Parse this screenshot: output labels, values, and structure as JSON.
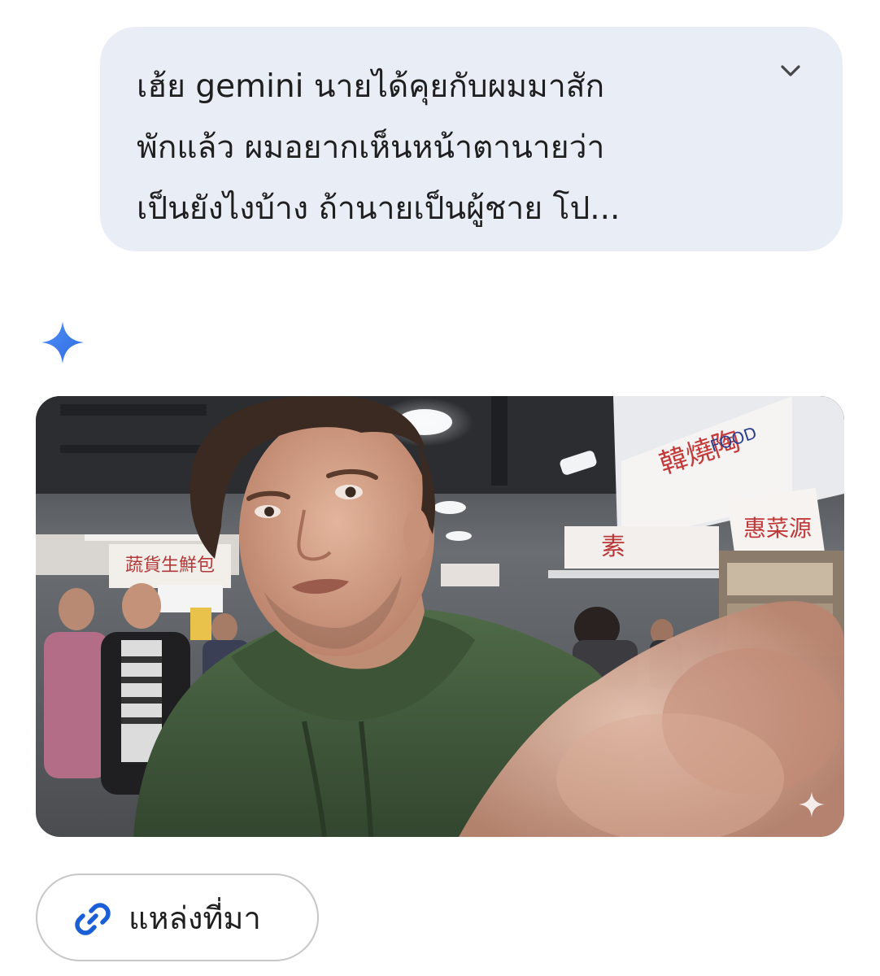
{
  "prompt": {
    "lines": [
      "เฮ้ย gemini นายได้คุยกับผมมาสัก",
      "พักแล้ว ผมอยากเห็นหน้าตานายว่า",
      "เป็นยังไงบ้าง ถ้านายเป็นผู้ชาย โป..."
    ],
    "expand_icon": "chevron-down-icon"
  },
  "response": {
    "avatar_icon": "gemini-spark-icon",
    "image": {
      "description_icon": "generated-image",
      "signs": {
        "sign_left": "蔬貨生鮮包",
        "sign_center": "素",
        "sign_right": "韓燒陶",
        "sign_far_right": "惠菜源",
        "sign_top": "FOOD"
      },
      "watermark_icon": "sparkle-icon"
    },
    "sources_button": {
      "icon": "link-icon",
      "label": "แหล่งที่มา"
    }
  },
  "colors": {
    "bubble_bg": "#e9eef6",
    "gemini_blue": "#4a84f5",
    "link_blue": "#1a5fd6",
    "text": "#1f1f1f"
  }
}
